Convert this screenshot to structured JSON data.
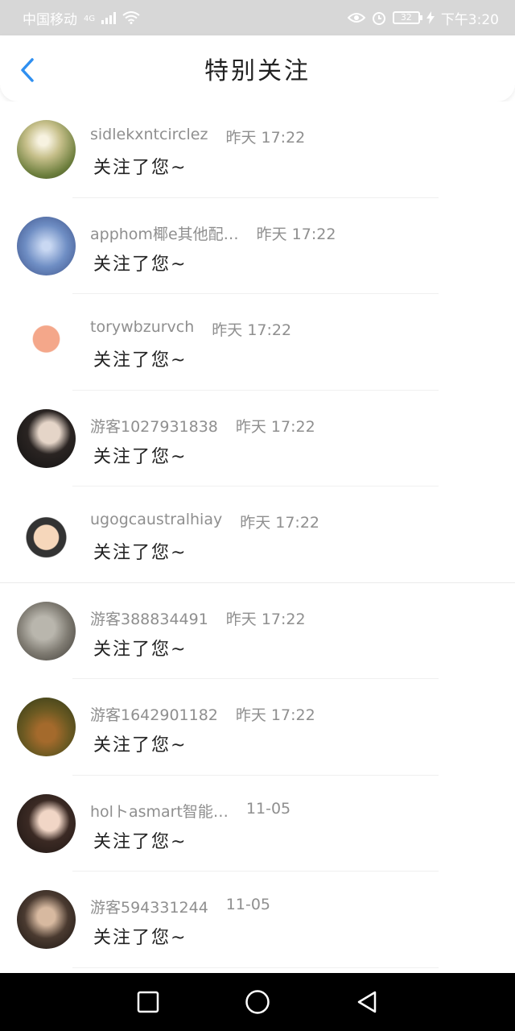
{
  "status_bar": {
    "carrier": "中国移动",
    "network": "4G",
    "battery": "32",
    "time": "下午3:20"
  },
  "header": {
    "title": "特别关注",
    "back_icon": "chevron-left-icon"
  },
  "colors": {
    "accent": "#2f8ff0",
    "status_bar_bg": "#d7d7d7",
    "nav_bar_bg": "#000000"
  },
  "items": [
    {
      "name": "sidlekxntcirclez",
      "time": "昨天 17:22",
      "message": "关注了您~"
    },
    {
      "name": "apphom椰e其他配…",
      "time": "昨天 17:22",
      "message": "关注了您~"
    },
    {
      "name": "torywbzurvch",
      "time": "昨天 17:22",
      "message": "关注了您~"
    },
    {
      "name": "游客1027931838",
      "time": "昨天 17:22",
      "message": "关注了您~"
    },
    {
      "name": "ugogcaustralhiay",
      "time": "昨天 17:22",
      "message": "关注了您~"
    },
    {
      "name": "游客388834491",
      "time": "昨天 17:22",
      "message": "关注了您~"
    },
    {
      "name": "游客1642901182",
      "time": "昨天 17:22",
      "message": "关注了您~"
    },
    {
      "name": "holトasmart智能…",
      "time": "11-05",
      "message": "关注了您~"
    },
    {
      "name": "游客594331244",
      "time": "11-05",
      "message": "关注了您~"
    }
  ],
  "nav_bar": {
    "buttons": [
      "recent-apps-icon",
      "home-icon",
      "back-triangle-icon"
    ]
  }
}
